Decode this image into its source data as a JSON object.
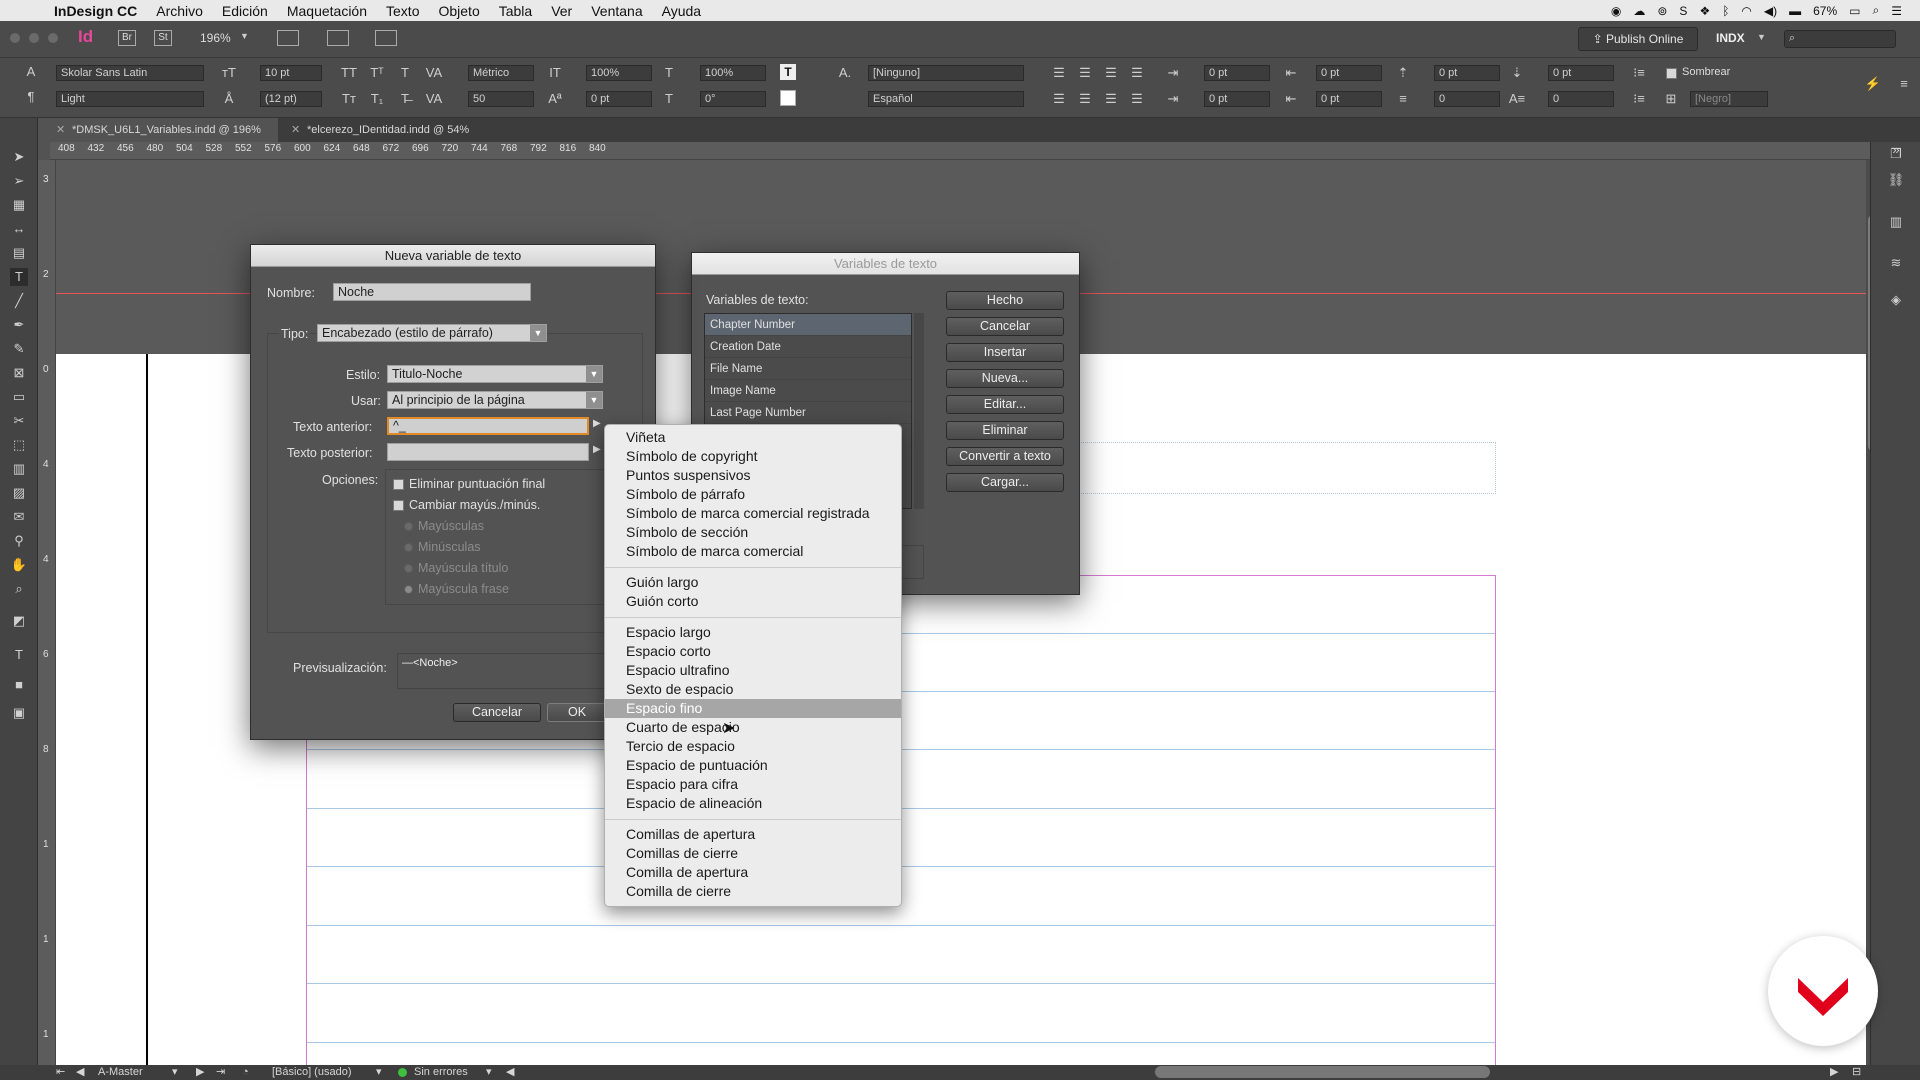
{
  "menubar": {
    "app": "InDesign CC",
    "items": [
      "Archivo",
      "Edición",
      "Maquetación",
      "Texto",
      "Objeto",
      "Tabla",
      "Ver",
      "Ventana",
      "Ayuda"
    ],
    "battery": "67%"
  },
  "appbar": {
    "app_icon": "Id",
    "bridge": "Br",
    "stock": "St",
    "zoom": "196%",
    "publish": "Publish Online",
    "workspace": "INDX"
  },
  "control": {
    "font": "Skolar Sans Latin",
    "style": "Light",
    "size": "10 pt",
    "leading": "(12 pt)",
    "kerning": "Métrico",
    "tracking": "50",
    "vscale": "100%",
    "hscale": "100%",
    "baseline": "0 pt",
    "skew": "0°",
    "char_style": "[Ninguno]",
    "language": "Español",
    "indent_left": "0 pt",
    "indent_right": "0 pt",
    "first_line": "0 pt",
    "last_line": "0 pt",
    "space_before": "0 pt",
    "space_after": "0 pt",
    "drop_cap_lines": "0",
    "drop_cap_chars": "0",
    "shade": "Sombrear",
    "swatch": "[Negro]"
  },
  "tabs": [
    {
      "label": "*DMSK_U6L1_Variables.indd @ 196%"
    },
    {
      "label": "*elcerezo_IDentidad.indd @ 54%"
    }
  ],
  "ruler": {
    "h": [
      "408",
      "432",
      "456",
      "480",
      "504",
      "528",
      "552",
      "576",
      "600",
      "624",
      "648",
      "672",
      "696",
      "720",
      "744",
      "768",
      "792",
      "816",
      "840"
    ],
    "v": [
      "3",
      "2",
      "0",
      "4",
      "4",
      "6",
      "8",
      "1",
      "1",
      "1"
    ]
  },
  "dialog_new": {
    "title": "Nueva variable de texto",
    "name_label": "Nombre:",
    "name_value": "Noche",
    "type_label": "Tipo:",
    "type_value": "Encabezado (estilo de párrafo)",
    "style_label": "Estilo:",
    "style_value": "Titulo-Noche",
    "use_label": "Usar:",
    "use_value": "Al principio de la página",
    "before_label": "Texto anterior:",
    "before_value": "^_",
    "after_label": "Texto posterior:",
    "after_value": "",
    "options_label": "Opciones:",
    "opt_remove_punct": "Eliminar puntuación final",
    "opt_change_case": "Cambiar mayús./minús.",
    "case_upper": "Mayúsculas",
    "case_lower": "Minúsculas",
    "case_title": "Mayúscula título",
    "case_sentence": "Mayúscula frase",
    "preview_label": "Previsualización:",
    "preview_value": "—<Noche>",
    "cancel": "Cancelar",
    "ok": "OK"
  },
  "dialog_vars": {
    "title": "Variables de texto",
    "list_label": "Variables de texto:",
    "items": [
      "Chapter Number",
      "Creation Date",
      "File Name",
      "Image Name",
      "Last Page Number"
    ],
    "buttons": [
      "Hecho",
      "Cancelar",
      "Insertar",
      "Nueva...",
      "Editar...",
      "Eliminar",
      "Convertir a texto",
      "Cargar..."
    ]
  },
  "menu": {
    "groups": [
      [
        "Viñeta",
        "Símbolo de copyright",
        "Puntos suspensivos",
        "Símbolo de párrafo",
        "Símbolo de marca comercial registrada",
        "Símbolo de sección",
        "Símbolo de marca comercial"
      ],
      [
        "Guión largo",
        "Guión corto"
      ],
      [
        "Espacio largo",
        "Espacio corto",
        "Espacio ultrafino",
        "Sexto de espacio",
        "Espacio fino",
        "Cuarto de espacio",
        "Tercio de espacio",
        "Espacio de puntuación",
        "Espacio para cifra",
        "Espacio de alineación"
      ],
      [
        "Comillas de apertura",
        "Comillas de cierre",
        "Comilla de apertura",
        "Comilla de cierre"
      ]
    ],
    "highlighted": "Espacio fino"
  },
  "status": {
    "page": "A-Master",
    "style": "[Básico] (usado)",
    "errors": "Sin errores"
  },
  "colors": {
    "accent_focus": "#e08a2a",
    "logo_red": "#e0001b",
    "ok_green": "#3fbf3f"
  }
}
